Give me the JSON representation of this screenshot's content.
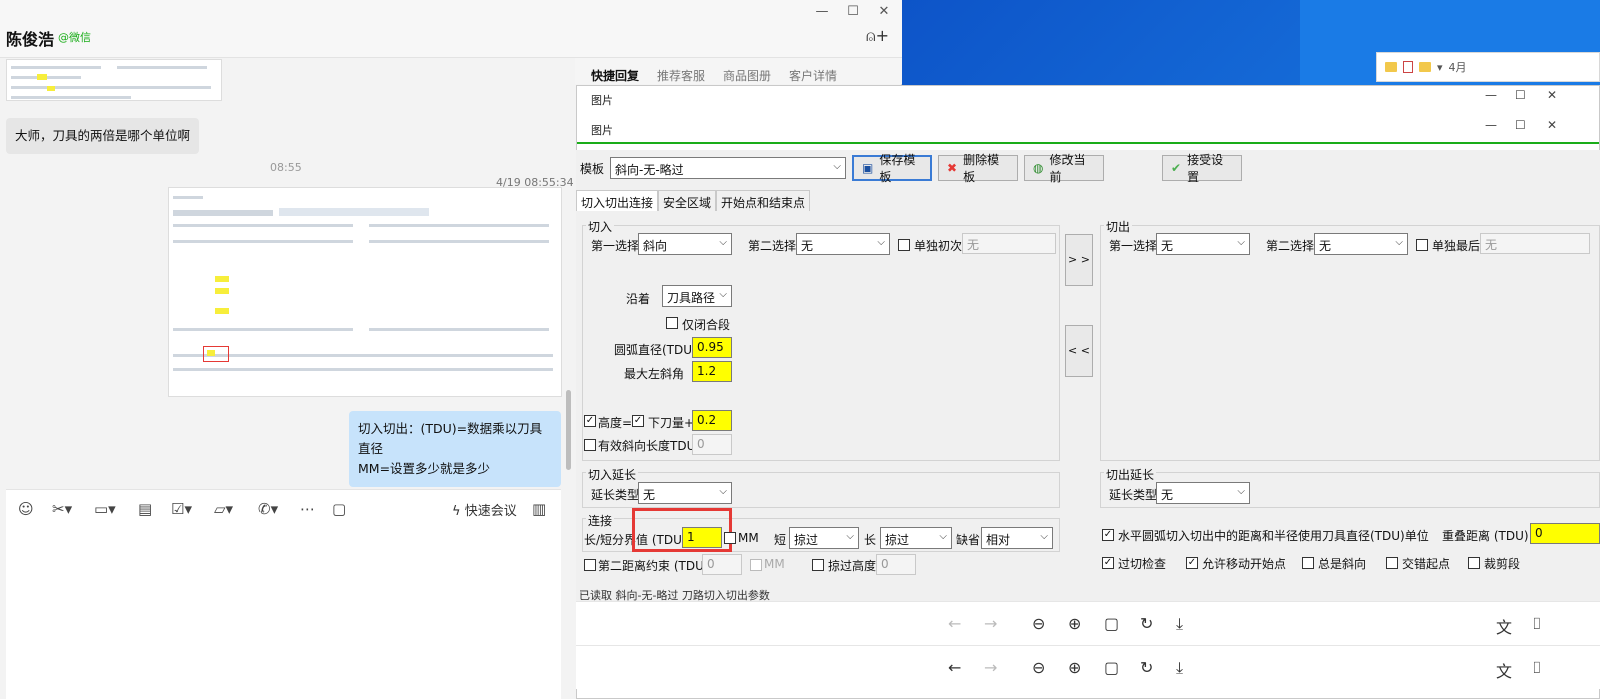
{
  "wechat": {
    "contact_name": "陈俊浩",
    "contact_tag": "@微信",
    "messages": {
      "left_text": "大师，刀具的两倍是哪个单位啊",
      "time1": "08:55",
      "time2": "4/19 08:55:34",
      "right_text_line1": "切入切出：(TDU)=数据乘以刀具直径",
      "right_text_line2": "MM=设置多少就是多少"
    },
    "side_tabs": [
      "快捷回复",
      "推荐客服",
      "商品图册",
      "客户详情"
    ],
    "quick_meeting": "快速会议"
  },
  "desktop": {
    "explorer_text": "4月"
  },
  "viewer": {
    "title1": "图片",
    "title2": "图片"
  },
  "app": {
    "template_label": "模板",
    "template_value": "斜向-无-略过",
    "buttons": {
      "save": "保存模板",
      "delete": "删除模板",
      "modify": "修改当前",
      "accept": "接受设置"
    },
    "tabs": [
      "切入切出连接",
      "安全区域",
      "开始点和结束点"
    ],
    "lead_in": {
      "title": "切入",
      "first_choice_label": "第一选择",
      "first_choice": "斜向",
      "second_choice_label": "第二选择",
      "second_choice": "无",
      "single_first_label": "单独初次",
      "single_first": "无",
      "along_label": "沿着",
      "along": "刀具路径",
      "closed_only": "仅闭合段",
      "arc_dia_label": "圆弧直径(TDU)",
      "arc_dia": "0.95",
      "max_ramp_label": "最大左斜角",
      "max_ramp": "1.2",
      "height_label": "高度=",
      "plunge_label": "下刀量+",
      "plunge": "0.2",
      "eff_ramp_label": "有效斜向长度TDU",
      "eff_ramp": "0"
    },
    "lead_out": {
      "title": "切出",
      "first_choice_label": "第一选择",
      "first_choice": "无",
      "second_choice_label": "第二选择",
      "second_choice": "无",
      "single_last_label": "单独最后",
      "single_last": "无"
    },
    "arrows": {
      "right": "> >",
      "left": "< <"
    },
    "ext_in": {
      "title": "切入延长",
      "type_label": "延长类型",
      "type": "无"
    },
    "ext_out": {
      "title": "切出延长",
      "type_label": "延长类型",
      "type": "无"
    },
    "links": {
      "title": "连接",
      "short_long_label": "长/短分界值 (TDU)",
      "short_long": "1",
      "mm": "MM",
      "short_label": "短",
      "short": "掠过",
      "long_label": "长",
      "long": "掠过",
      "default_label": "缺省",
      "default": "相对",
      "second_dist_label": "第二距离约束 (TDU)",
      "second_dist": "0",
      "mm2": "MM",
      "skim_height_label": "掠过高度",
      "skim_height": "0"
    },
    "options": {
      "arc_tdu": "水平圆弧切入切出中的距离和半径使用刀具直径(TDU)单位",
      "overlap_label": "重叠距离 (TDU)",
      "overlap": "0",
      "gouge_check": "过切检查",
      "allow_move_start": "允许移动开始点",
      "always_ramp": "总是斜向",
      "stagger_start": "交错起点",
      "trim_segment": "裁剪段"
    },
    "status": "已读取 斜向-无-略过 刀路切入切出参数"
  }
}
